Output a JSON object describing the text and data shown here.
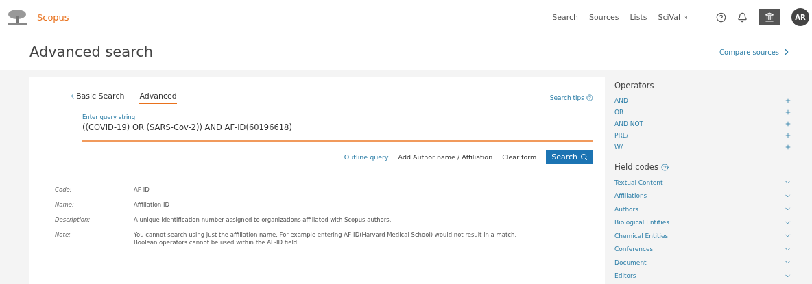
{
  "header": {
    "brand": "Scopus",
    "nav": [
      {
        "label": "Search",
        "external": false
      },
      {
        "label": "Sources",
        "external": false
      },
      {
        "label": "Lists",
        "external": false
      },
      {
        "label": "SciVal",
        "external": true
      }
    ],
    "avatar": "AR"
  },
  "page": {
    "title": "Advanced search",
    "compare_link": "Compare sources"
  },
  "tabs": [
    {
      "label": "Basic Search",
      "selected": false,
      "back": true
    },
    {
      "label": "Advanced",
      "selected": true,
      "back": false
    }
  ],
  "search_tips": "Search tips",
  "query": {
    "label": "Enter query string",
    "value": "((COVID-19) OR (SARS-Cov-2)) AND AF-ID(60196618)"
  },
  "actions": [
    {
      "label": "Outline query",
      "kind": "link"
    },
    {
      "label": "Add Author name / Affiliation",
      "kind": "plain"
    },
    {
      "label": "Clear form",
      "kind": "plain"
    },
    {
      "label": "Search",
      "kind": "primary"
    }
  ],
  "details": [
    {
      "term": "Code:",
      "lines": [
        "AF-ID"
      ]
    },
    {
      "term": "Name:",
      "lines": [
        "Affiliation ID"
      ]
    },
    {
      "term": "Description:",
      "lines": [
        "A unique identification number assigned to organizations affiliated with Scopus authors."
      ]
    },
    {
      "term": "Note:",
      "lines": [
        "You cannot search using just the affiliation name. For example entering AF-ID(Harvard Medical School) would not result in a match.",
        "Boolean operators cannot be used within the AF-ID field."
      ]
    }
  ],
  "operators": {
    "title": "Operators",
    "items": [
      "AND",
      "OR",
      "AND NOT",
      "PRE/",
      "W/"
    ]
  },
  "field_codes": {
    "title": "Field codes",
    "items": [
      {
        "label": "Textual Content",
        "expanded": false
      },
      {
        "label": "Affiliations",
        "expanded": false
      },
      {
        "label": "Authors",
        "expanded": false
      },
      {
        "label": "Biological Entities",
        "expanded": false
      },
      {
        "label": "Chemical Entities",
        "expanded": false
      },
      {
        "label": "Conferences",
        "expanded": false
      },
      {
        "label": "Document",
        "expanded": false
      },
      {
        "label": "Editors",
        "expanded": false
      }
    ]
  }
}
